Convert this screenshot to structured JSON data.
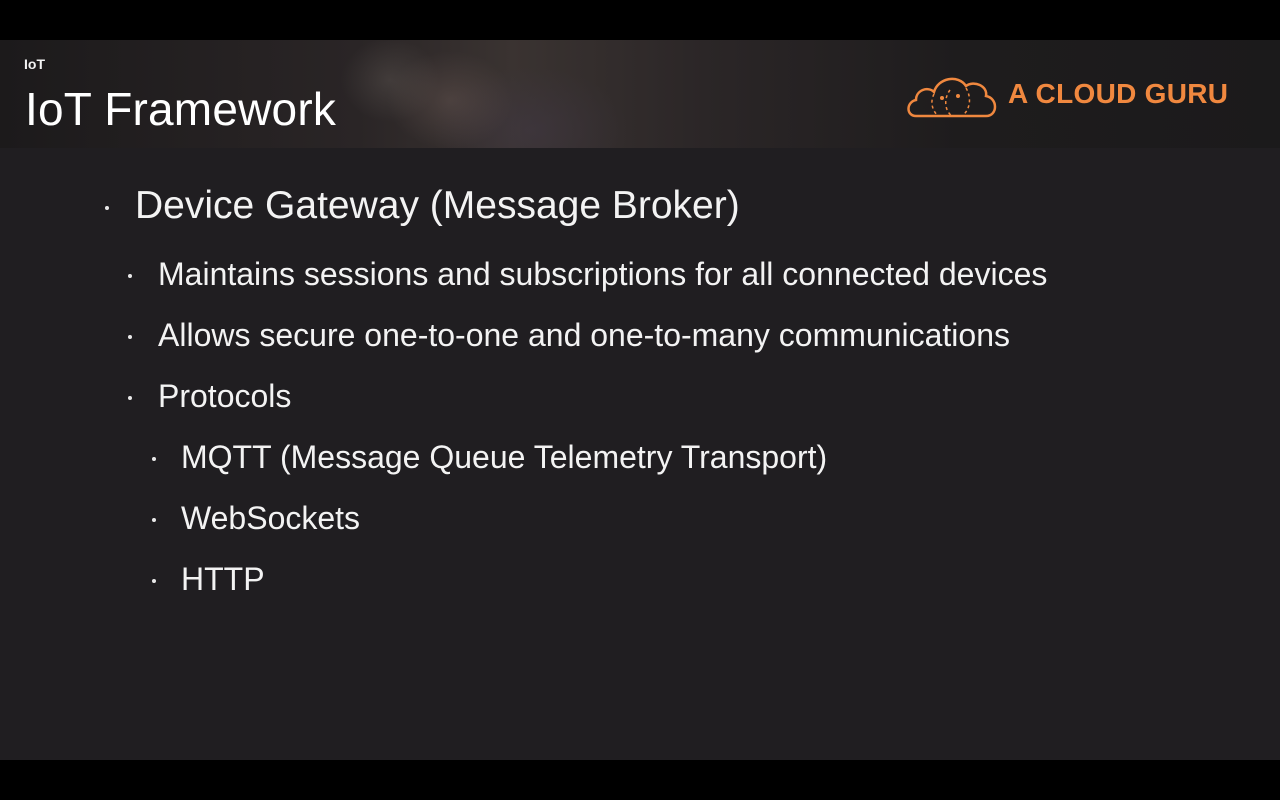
{
  "header": {
    "breadcrumb": "IoT",
    "title": "IoT Framework",
    "logo_text": "A CLOUD GURU",
    "logo_icon": "cloud-logo-icon",
    "brand_color": "#f0883f"
  },
  "content": {
    "heading": "Device Gateway (Message Broker)",
    "items": [
      "Maintains sessions and subscriptions for all connected devices",
      "Allows secure one-to-one and one-to-many communications",
      "Protocols"
    ],
    "protocols": [
      "MQTT (Message Queue Telemetry Transport)",
      "WebSockets",
      "HTTP"
    ]
  }
}
